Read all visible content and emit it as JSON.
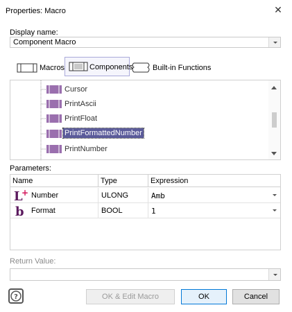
{
  "window": {
    "title": "Properties: Macro"
  },
  "display_name": {
    "label": "Display name:",
    "value": "Component Macro"
  },
  "tabs": [
    {
      "label": "Macros"
    },
    {
      "label": "Components"
    },
    {
      "label": "Built-in Functions"
    }
  ],
  "tree": {
    "items": [
      {
        "label": "Cursor",
        "selected": false
      },
      {
        "label": "PrintAscii",
        "selected": false
      },
      {
        "label": "PrintFloat",
        "selected": false
      },
      {
        "label": "PrintFormattedNumber",
        "selected": true
      },
      {
        "label": "PrintNumber",
        "selected": false
      }
    ]
  },
  "parameters": {
    "label": "Parameters:",
    "columns": [
      "Name",
      "Type",
      "Expression"
    ],
    "rows": [
      {
        "icon": "integer-type-icon",
        "name": "Number",
        "type": "ULONG",
        "expression": "Amb"
      },
      {
        "icon": "boolean-type-icon",
        "name": "Format",
        "type": "BOOL",
        "expression": "1"
      }
    ]
  },
  "return_value": {
    "label": "Return Value:",
    "value": ""
  },
  "buttons": {
    "ok_edit": "OK & Edit Macro",
    "ok": "OK",
    "cancel": "Cancel"
  },
  "colors": {
    "accent": "#5b5b9a",
    "tab_border": "#a9a9d9",
    "icon_purple": "#5b1a5e"
  }
}
